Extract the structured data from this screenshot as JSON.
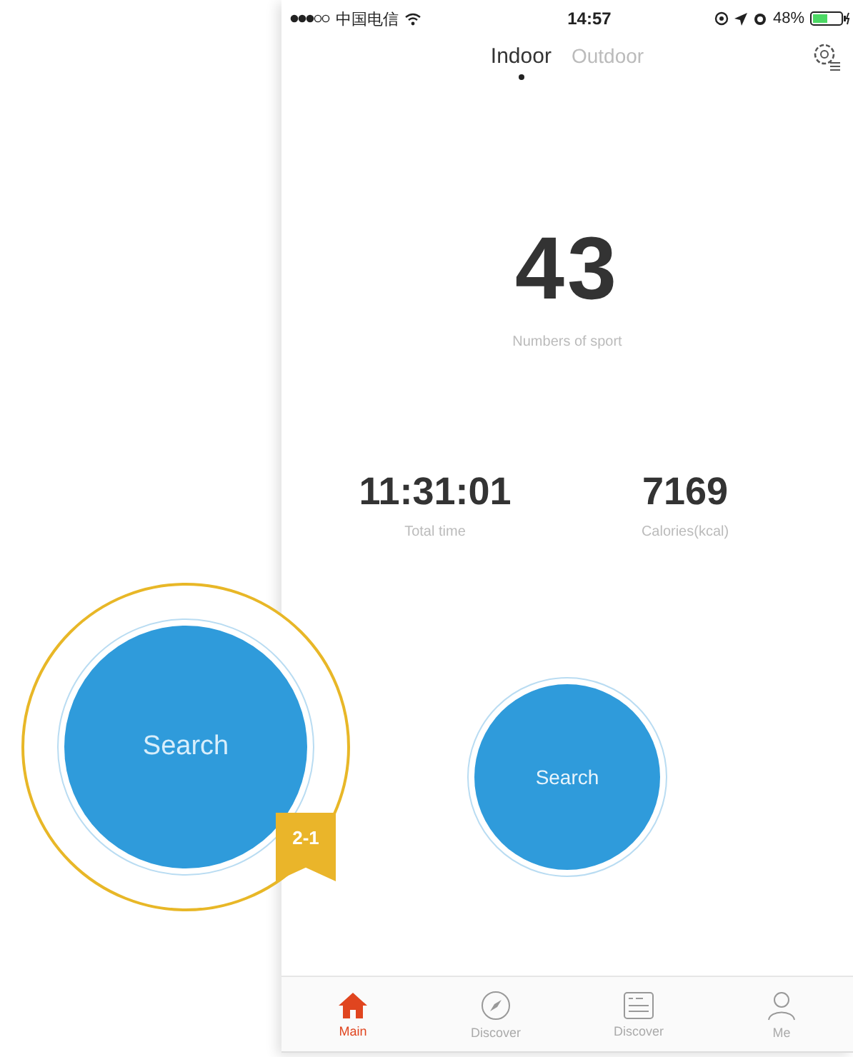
{
  "status_bar": {
    "carrier": "中国电信",
    "time": "14:57",
    "battery": "48%"
  },
  "tabs": [
    {
      "label": "Indoor",
      "selected": true
    },
    {
      "label": "Outdoor",
      "selected": false
    }
  ],
  "hero": {
    "value": "43",
    "label": "Numbers of sport"
  },
  "stats": [
    {
      "value": "11:31:01",
      "label": "Total time"
    },
    {
      "value": "7169",
      "label": "Calories(kcal)"
    }
  ],
  "search_button": {
    "label": "Search"
  },
  "callout": {
    "label": "Search",
    "badge": "2-1"
  },
  "nav": [
    {
      "kind": "home",
      "label": "Main",
      "selected": true
    },
    {
      "kind": "compass",
      "label": "Discover",
      "selected": false
    },
    {
      "kind": "card",
      "label": "Discover",
      "selected": false
    },
    {
      "kind": "person",
      "label": "Me",
      "selected": false
    }
  ]
}
